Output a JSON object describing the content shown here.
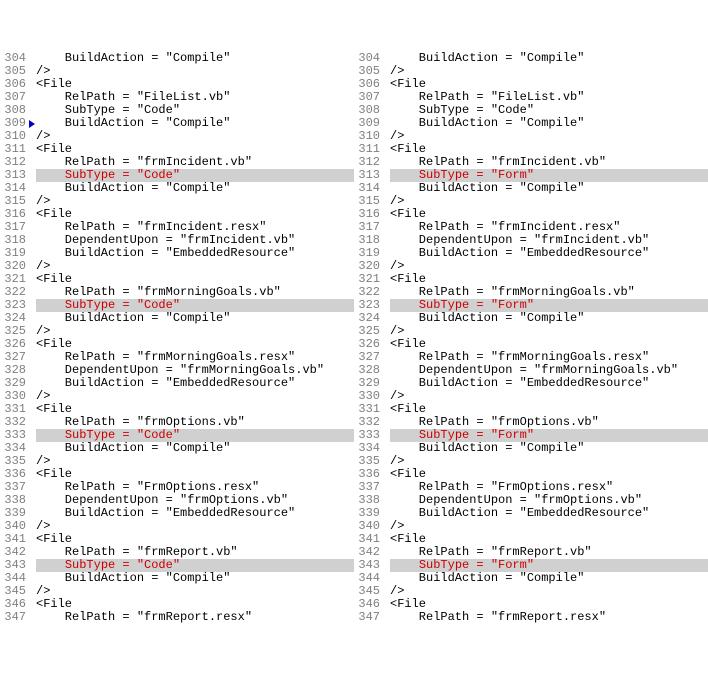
{
  "panes": [
    {
      "side": "left",
      "lines": [
        {
          "n": 304,
          "m": false,
          "hl": false,
          "seg": [
            {
              "t": "    BuildAction = \"Compile\""
            }
          ]
        },
        {
          "n": 305,
          "m": false,
          "hl": false,
          "seg": [
            {
              "t": "/>"
            }
          ]
        },
        {
          "n": 306,
          "m": false,
          "hl": false,
          "seg": [
            {
              "t": "<File"
            }
          ]
        },
        {
          "n": 307,
          "m": false,
          "hl": false,
          "seg": [
            {
              "t": "    RelPath = \"FileList.vb\""
            }
          ]
        },
        {
          "n": 308,
          "m": false,
          "hl": false,
          "seg": [
            {
              "t": "    SubType = \"Code\""
            }
          ]
        },
        {
          "n": 309,
          "m": true,
          "hl": false,
          "seg": [
            {
              "t": "    BuildAction = \"Compile\""
            }
          ]
        },
        {
          "n": 310,
          "m": false,
          "hl": false,
          "seg": [
            {
              "t": "/>"
            }
          ]
        },
        {
          "n": 311,
          "m": false,
          "hl": false,
          "seg": [
            {
              "t": "<File"
            }
          ]
        },
        {
          "n": 312,
          "m": false,
          "hl": false,
          "seg": [
            {
              "t": "    RelPath = \"frmIncident.vb\""
            }
          ]
        },
        {
          "n": 313,
          "m": false,
          "hl": true,
          "seg": [
            {
              "t": "    "
            },
            {
              "t": "SubType = \"Code\"",
              "d": true
            }
          ]
        },
        {
          "n": 314,
          "m": false,
          "hl": false,
          "seg": [
            {
              "t": "    BuildAction = \"Compile\""
            }
          ]
        },
        {
          "n": 315,
          "m": false,
          "hl": false,
          "seg": [
            {
              "t": "/>"
            }
          ]
        },
        {
          "n": 316,
          "m": false,
          "hl": false,
          "seg": [
            {
              "t": "<File"
            }
          ]
        },
        {
          "n": 317,
          "m": false,
          "hl": false,
          "seg": [
            {
              "t": "    RelPath = \"frmIncident.resx\""
            }
          ]
        },
        {
          "n": 318,
          "m": false,
          "hl": false,
          "seg": [
            {
              "t": "    DependentUpon = \"frmIncident.vb\""
            }
          ]
        },
        {
          "n": 319,
          "m": false,
          "hl": false,
          "seg": [
            {
              "t": "    BuildAction = \"EmbeddedResource\""
            }
          ]
        },
        {
          "n": 320,
          "m": false,
          "hl": false,
          "seg": [
            {
              "t": "/>"
            }
          ]
        },
        {
          "n": 321,
          "m": false,
          "hl": false,
          "seg": [
            {
              "t": "<File"
            }
          ]
        },
        {
          "n": 322,
          "m": false,
          "hl": false,
          "seg": [
            {
              "t": "    RelPath = \"frmMorningGoals.vb\""
            }
          ]
        },
        {
          "n": 323,
          "m": false,
          "hl": true,
          "seg": [
            {
              "t": "    "
            },
            {
              "t": "SubType = \"Code\"",
              "d": true
            }
          ]
        },
        {
          "n": 324,
          "m": false,
          "hl": false,
          "seg": [
            {
              "t": "    BuildAction = \"Compile\""
            }
          ]
        },
        {
          "n": 325,
          "m": false,
          "hl": false,
          "seg": [
            {
              "t": "/>"
            }
          ]
        },
        {
          "n": 326,
          "m": false,
          "hl": false,
          "seg": [
            {
              "t": "<File"
            }
          ]
        },
        {
          "n": 327,
          "m": false,
          "hl": false,
          "seg": [
            {
              "t": "    RelPath = \"frmMorningGoals.resx\""
            }
          ]
        },
        {
          "n": 328,
          "m": false,
          "hl": false,
          "seg": [
            {
              "t": "    DependentUpon = \"frmMorningGoals.vb\""
            }
          ]
        },
        {
          "n": 329,
          "m": false,
          "hl": false,
          "seg": [
            {
              "t": "    BuildAction = \"EmbeddedResource\""
            }
          ]
        },
        {
          "n": 330,
          "m": false,
          "hl": false,
          "seg": [
            {
              "t": "/>"
            }
          ]
        },
        {
          "n": 331,
          "m": false,
          "hl": false,
          "seg": [
            {
              "t": "<File"
            }
          ]
        },
        {
          "n": 332,
          "m": false,
          "hl": false,
          "seg": [
            {
              "t": "    RelPath = \"frmOptions.vb\""
            }
          ]
        },
        {
          "n": 333,
          "m": false,
          "hl": true,
          "seg": [
            {
              "t": "    "
            },
            {
              "t": "SubType = \"Code\"",
              "d": true
            }
          ]
        },
        {
          "n": 334,
          "m": false,
          "hl": false,
          "seg": [
            {
              "t": "    BuildAction = \"Compile\""
            }
          ]
        },
        {
          "n": 335,
          "m": false,
          "hl": false,
          "seg": [
            {
              "t": "/>"
            }
          ]
        },
        {
          "n": 336,
          "m": false,
          "hl": false,
          "seg": [
            {
              "t": "<File"
            }
          ]
        },
        {
          "n": 337,
          "m": false,
          "hl": false,
          "seg": [
            {
              "t": "    RelPath = \"FrmOptions.resx\""
            }
          ]
        },
        {
          "n": 338,
          "m": false,
          "hl": false,
          "seg": [
            {
              "t": "    DependentUpon = \"frmOptions.vb\""
            }
          ]
        },
        {
          "n": 339,
          "m": false,
          "hl": false,
          "seg": [
            {
              "t": "    BuildAction = \"EmbeddedResource\""
            }
          ]
        },
        {
          "n": 340,
          "m": false,
          "hl": false,
          "seg": [
            {
              "t": "/>"
            }
          ]
        },
        {
          "n": 341,
          "m": false,
          "hl": false,
          "seg": [
            {
              "t": "<File"
            }
          ]
        },
        {
          "n": 342,
          "m": false,
          "hl": false,
          "seg": [
            {
              "t": "    RelPath = \"frmReport.vb\""
            }
          ]
        },
        {
          "n": 343,
          "m": false,
          "hl": true,
          "seg": [
            {
              "t": "    "
            },
            {
              "t": "SubType = \"Code\"",
              "d": true
            }
          ]
        },
        {
          "n": 344,
          "m": false,
          "hl": false,
          "seg": [
            {
              "t": "    BuildAction = \"Compile\""
            }
          ]
        },
        {
          "n": 345,
          "m": false,
          "hl": false,
          "seg": [
            {
              "t": "/>"
            }
          ]
        },
        {
          "n": 346,
          "m": false,
          "hl": false,
          "seg": [
            {
              "t": "<File"
            }
          ]
        },
        {
          "n": 347,
          "m": false,
          "hl": false,
          "seg": [
            {
              "t": "    RelPath = \"frmReport.resx\""
            }
          ]
        }
      ]
    },
    {
      "side": "right",
      "lines": [
        {
          "n": 304,
          "m": false,
          "hl": false,
          "seg": [
            {
              "t": "    BuildAction = \"Compile\""
            }
          ]
        },
        {
          "n": 305,
          "m": false,
          "hl": false,
          "seg": [
            {
              "t": "/>"
            }
          ]
        },
        {
          "n": 306,
          "m": false,
          "hl": false,
          "seg": [
            {
              "t": "<File"
            }
          ]
        },
        {
          "n": 307,
          "m": false,
          "hl": false,
          "seg": [
            {
              "t": "    RelPath = \"FileList.vb\""
            }
          ]
        },
        {
          "n": 308,
          "m": false,
          "hl": false,
          "seg": [
            {
              "t": "    SubType = \"Code\""
            }
          ]
        },
        {
          "n": 309,
          "m": false,
          "hl": false,
          "seg": [
            {
              "t": "    BuildAction = \"Compile\""
            }
          ]
        },
        {
          "n": 310,
          "m": false,
          "hl": false,
          "seg": [
            {
              "t": "/>"
            }
          ]
        },
        {
          "n": 311,
          "m": false,
          "hl": false,
          "seg": [
            {
              "t": "<File"
            }
          ]
        },
        {
          "n": 312,
          "m": false,
          "hl": false,
          "seg": [
            {
              "t": "    RelPath = \"frmIncident.vb\""
            }
          ]
        },
        {
          "n": 313,
          "m": false,
          "hl": true,
          "seg": [
            {
              "t": "    "
            },
            {
              "t": "SubType = \"Form\"",
              "d": true
            }
          ]
        },
        {
          "n": 314,
          "m": false,
          "hl": false,
          "seg": [
            {
              "t": "    BuildAction = \"Compile\""
            }
          ]
        },
        {
          "n": 315,
          "m": false,
          "hl": false,
          "seg": [
            {
              "t": "/>"
            }
          ]
        },
        {
          "n": 316,
          "m": false,
          "hl": false,
          "seg": [
            {
              "t": "<File"
            }
          ]
        },
        {
          "n": 317,
          "m": false,
          "hl": false,
          "seg": [
            {
              "t": "    RelPath = \"frmIncident.resx\""
            }
          ]
        },
        {
          "n": 318,
          "m": false,
          "hl": false,
          "seg": [
            {
              "t": "    DependentUpon = \"frmIncident.vb\""
            }
          ]
        },
        {
          "n": 319,
          "m": false,
          "hl": false,
          "seg": [
            {
              "t": "    BuildAction = \"EmbeddedResource\""
            }
          ]
        },
        {
          "n": 320,
          "m": false,
          "hl": false,
          "seg": [
            {
              "t": "/>"
            }
          ]
        },
        {
          "n": 321,
          "m": false,
          "hl": false,
          "seg": [
            {
              "t": "<File"
            }
          ]
        },
        {
          "n": 322,
          "m": false,
          "hl": false,
          "seg": [
            {
              "t": "    RelPath = \"frmMorningGoals.vb\""
            }
          ]
        },
        {
          "n": 323,
          "m": false,
          "hl": true,
          "seg": [
            {
              "t": "    "
            },
            {
              "t": "SubType = \"Form\"",
              "d": true
            }
          ]
        },
        {
          "n": 324,
          "m": false,
          "hl": false,
          "seg": [
            {
              "t": "    BuildAction = \"Compile\""
            }
          ]
        },
        {
          "n": 325,
          "m": false,
          "hl": false,
          "seg": [
            {
              "t": "/>"
            }
          ]
        },
        {
          "n": 326,
          "m": false,
          "hl": false,
          "seg": [
            {
              "t": "<File"
            }
          ]
        },
        {
          "n": 327,
          "m": false,
          "hl": false,
          "seg": [
            {
              "t": "    RelPath = \"frmMorningGoals.resx\""
            }
          ]
        },
        {
          "n": 328,
          "m": false,
          "hl": false,
          "seg": [
            {
              "t": "    DependentUpon = \"frmMorningGoals.vb\""
            }
          ]
        },
        {
          "n": 329,
          "m": false,
          "hl": false,
          "seg": [
            {
              "t": "    BuildAction = \"EmbeddedResource\""
            }
          ]
        },
        {
          "n": 330,
          "m": false,
          "hl": false,
          "seg": [
            {
              "t": "/>"
            }
          ]
        },
        {
          "n": 331,
          "m": false,
          "hl": false,
          "seg": [
            {
              "t": "<File"
            }
          ]
        },
        {
          "n": 332,
          "m": false,
          "hl": false,
          "seg": [
            {
              "t": "    RelPath = \"frmOptions.vb\""
            }
          ]
        },
        {
          "n": 333,
          "m": false,
          "hl": true,
          "seg": [
            {
              "t": "    "
            },
            {
              "t": "SubType = \"Form\"",
              "d": true
            }
          ]
        },
        {
          "n": 334,
          "m": false,
          "hl": false,
          "seg": [
            {
              "t": "    BuildAction = \"Compile\""
            }
          ]
        },
        {
          "n": 335,
          "m": false,
          "hl": false,
          "seg": [
            {
              "t": "/>"
            }
          ]
        },
        {
          "n": 336,
          "m": false,
          "hl": false,
          "seg": [
            {
              "t": "<File"
            }
          ]
        },
        {
          "n": 337,
          "m": false,
          "hl": false,
          "seg": [
            {
              "t": "    RelPath = \"FrmOptions.resx\""
            }
          ]
        },
        {
          "n": 338,
          "m": false,
          "hl": false,
          "seg": [
            {
              "t": "    DependentUpon = \"frmOptions.vb\""
            }
          ]
        },
        {
          "n": 339,
          "m": false,
          "hl": false,
          "seg": [
            {
              "t": "    BuildAction = \"EmbeddedResource\""
            }
          ]
        },
        {
          "n": 340,
          "m": false,
          "hl": false,
          "seg": [
            {
              "t": "/>"
            }
          ]
        },
        {
          "n": 341,
          "m": false,
          "hl": false,
          "seg": [
            {
              "t": "<File"
            }
          ]
        },
        {
          "n": 342,
          "m": false,
          "hl": false,
          "seg": [
            {
              "t": "    RelPath = \"frmReport.vb\""
            }
          ]
        },
        {
          "n": 343,
          "m": false,
          "hl": true,
          "seg": [
            {
              "t": "    "
            },
            {
              "t": "SubType = \"Form\"",
              "d": true
            }
          ]
        },
        {
          "n": 344,
          "m": false,
          "hl": false,
          "seg": [
            {
              "t": "    BuildAction = \"Compile\""
            }
          ]
        },
        {
          "n": 345,
          "m": false,
          "hl": false,
          "seg": [
            {
              "t": "/>"
            }
          ]
        },
        {
          "n": 346,
          "m": false,
          "hl": false,
          "seg": [
            {
              "t": "<File"
            }
          ]
        },
        {
          "n": 347,
          "m": false,
          "hl": false,
          "seg": [
            {
              "t": "    RelPath = \"frmReport.resx\""
            }
          ]
        }
      ]
    }
  ]
}
